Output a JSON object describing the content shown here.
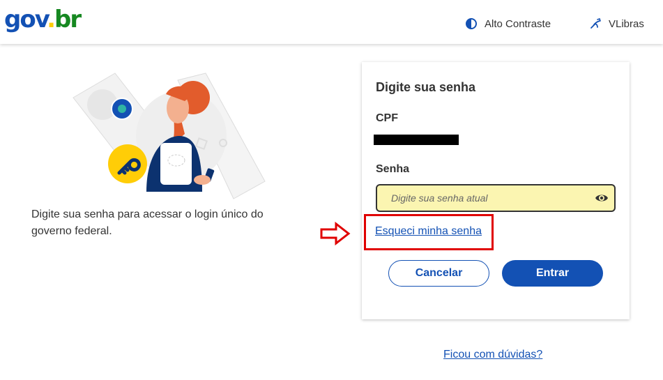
{
  "header": {
    "logo": {
      "part1": "gov",
      "part2": ".",
      "part3": "br"
    },
    "contrast_label": "Alto Contraste",
    "vlibras_label": "VLibras"
  },
  "intro": {
    "text": "Digite sua senha para acessar o login único do governo federal."
  },
  "login_card": {
    "title": "Digite sua senha",
    "cpf_label": "CPF",
    "password_label": "Senha",
    "password_placeholder": "Digite sua senha atual",
    "password_value": "",
    "forgot_link": "Esqueci minha senha",
    "cancel_button": "Cancelar",
    "enter_button": "Entrar"
  },
  "help_link": "Ficou com dúvidas?",
  "icons": {
    "contrast": "contrast-icon",
    "vlibras": "vlibras-hands-icon",
    "eye": "eye-icon",
    "annotation_arrow": "red-arrow"
  },
  "colors": {
    "brand_blue": "#1351b4",
    "field_background": "#fbf5b1",
    "highlight_red": "#e00000",
    "logo_yellow": "#ffcd07",
    "logo_green": "#168821"
  }
}
